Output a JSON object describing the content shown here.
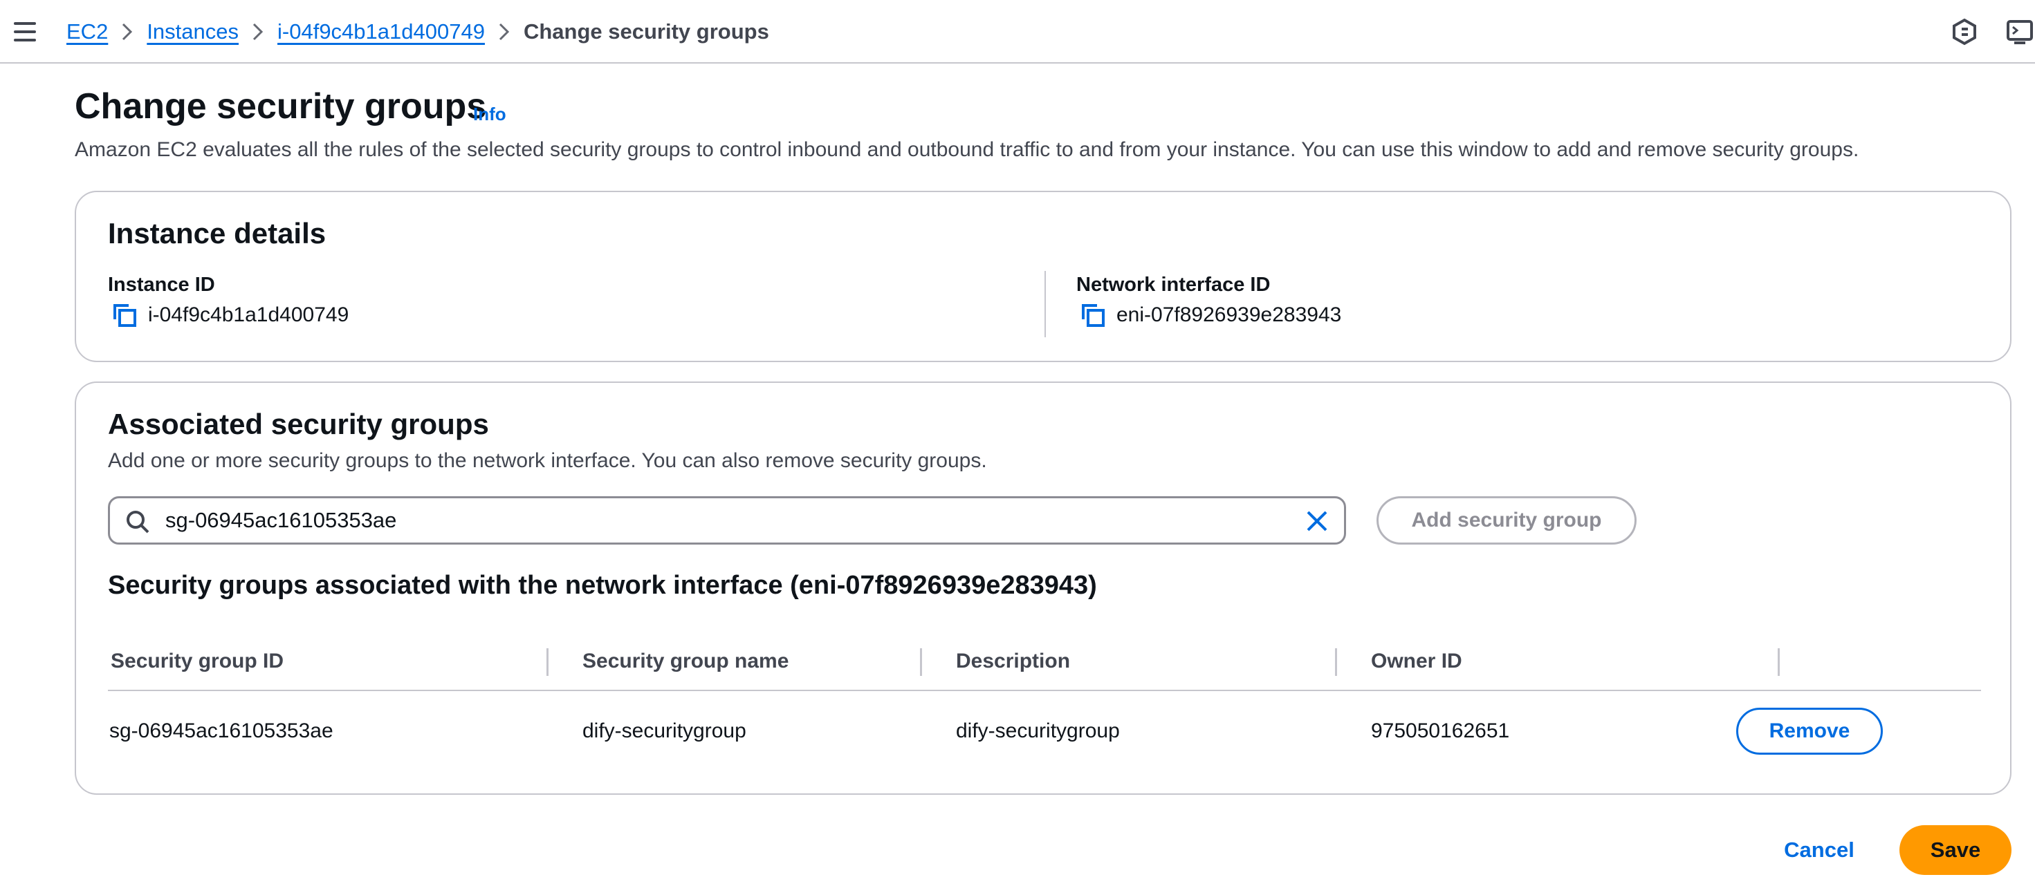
{
  "topbar": {
    "breadcrumb": [
      {
        "label": "EC2"
      },
      {
        "label": "Instances"
      },
      {
        "label": "i-04f9c4b1a1d400749"
      },
      {
        "label": "Change security groups"
      }
    ],
    "icons": [
      "menu-icon",
      "notifications-icon",
      "cloudshell-icon"
    ]
  },
  "page": {
    "title": "Change security groups",
    "info": "Info",
    "description": "Amazon EC2 evaluates all the rules of the selected security groups to control inbound and outbound traffic to and from your instance. You can use this window to add and remove security groups."
  },
  "instance_details": {
    "title": "Instance details",
    "instance_id_label": "Instance ID",
    "instance_id": "i-04f9c4b1a1d400749",
    "eni_label": "Network interface ID",
    "eni_id": "eni-07f8926939e283943"
  },
  "associated": {
    "title": "Associated security groups",
    "description": "Add one or more security groups to the network interface. You can also remove security groups.",
    "search_value": "sg-06945ac16105353ae",
    "add_button": "Add security group",
    "table_heading": "Security groups associated with the network interface (eni-07f8926939e283943)",
    "columns": [
      "Security group ID",
      "Security group name",
      "Description",
      "Owner ID"
    ],
    "rows": [
      {
        "id": "sg-06945ac16105353ae",
        "name": "dify-securitygroup",
        "description": "dify-securitygroup",
        "owner": "975050162651",
        "action": "Remove"
      }
    ]
  },
  "footer": {
    "cancel": "Cancel",
    "save": "Save"
  },
  "colors": {
    "link": "#006ce0",
    "primary_button": "#ff9900",
    "border": "#c6c6cd"
  }
}
